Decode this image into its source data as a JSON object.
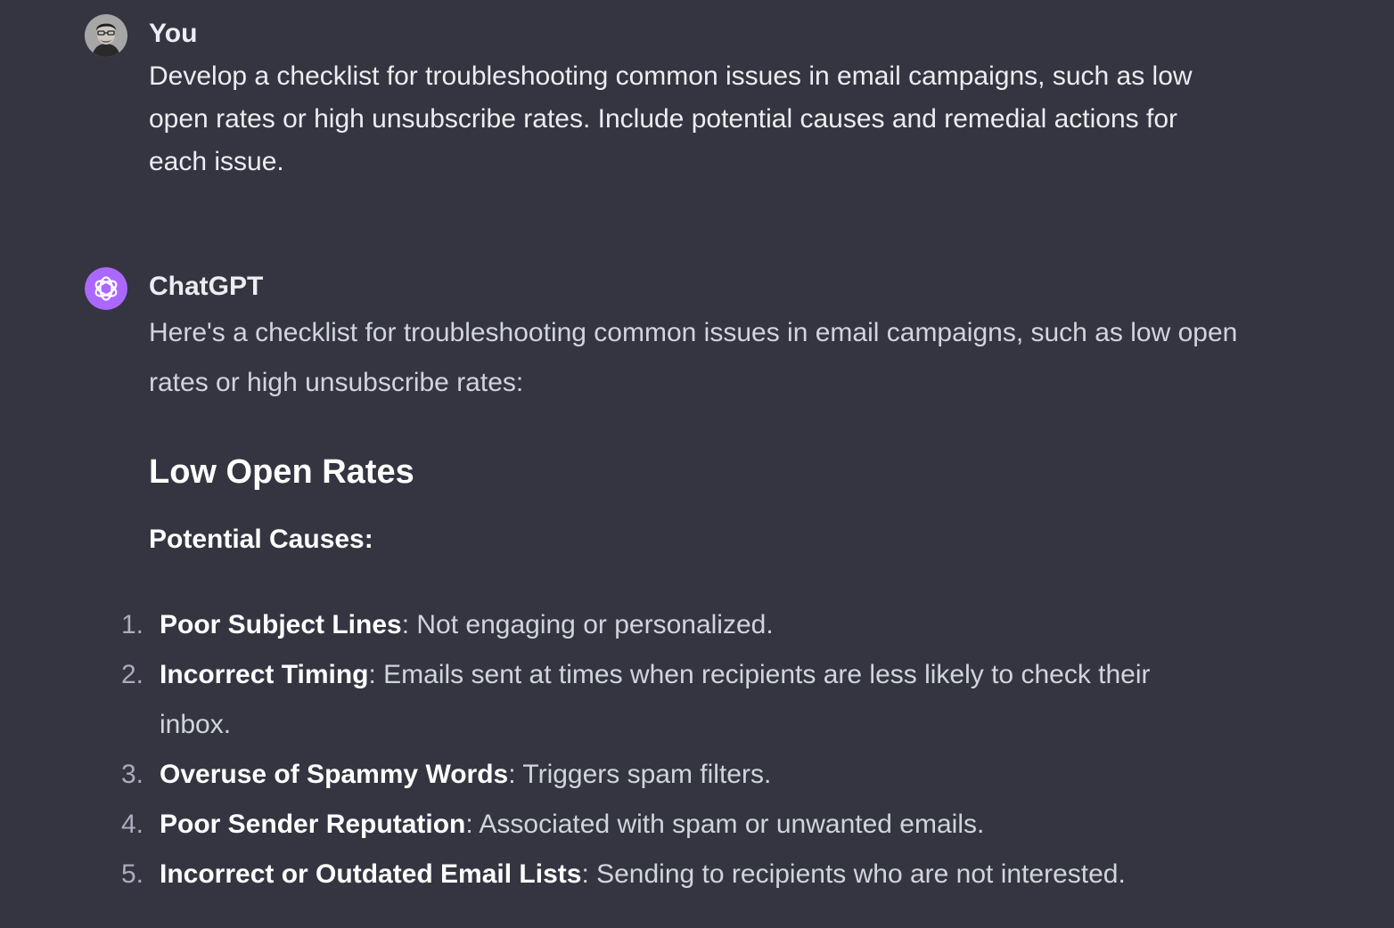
{
  "conversation": {
    "user_message": {
      "author": "You",
      "text": "Develop a checklist for troubleshooting common issues in email campaigns, such as low open rates or high unsubscribe rates. Include potential causes and remedial actions for each issue."
    },
    "assistant_message": {
      "author": "ChatGPT",
      "intro": "Here's a checklist for troubleshooting common issues in email campaigns, such as low open rates or high unsubscribe rates:",
      "section_heading": "Low Open Rates",
      "causes_heading": "Potential Causes:",
      "causes": [
        {
          "number": "1.",
          "title": "Poor Subject Lines",
          "desc": ": Not engaging or personalized."
        },
        {
          "number": "2.",
          "title": "Incorrect Timing",
          "desc": ": Emails sent at times when recipients are less likely to check their inbox."
        },
        {
          "number": "3.",
          "title": "Overuse of Spammy Words",
          "desc": ": Triggers spam filters."
        },
        {
          "number": "4.",
          "title": "Poor Sender Reputation",
          "desc": ": Associated with spam or unwanted emails."
        },
        {
          "number": "5.",
          "title": "Incorrect or Outdated Email Lists",
          "desc": ": Sending to recipients who are not interested."
        }
      ]
    }
  },
  "icons": {
    "user_avatar": "user-avatar-photo",
    "assistant_avatar": "openai-logo-icon"
  },
  "colors": {
    "background": "#343541",
    "assistant_avatar_bg": "#ab68ff",
    "text_primary": "#ececf1",
    "text_secondary": "#d1d5db"
  }
}
